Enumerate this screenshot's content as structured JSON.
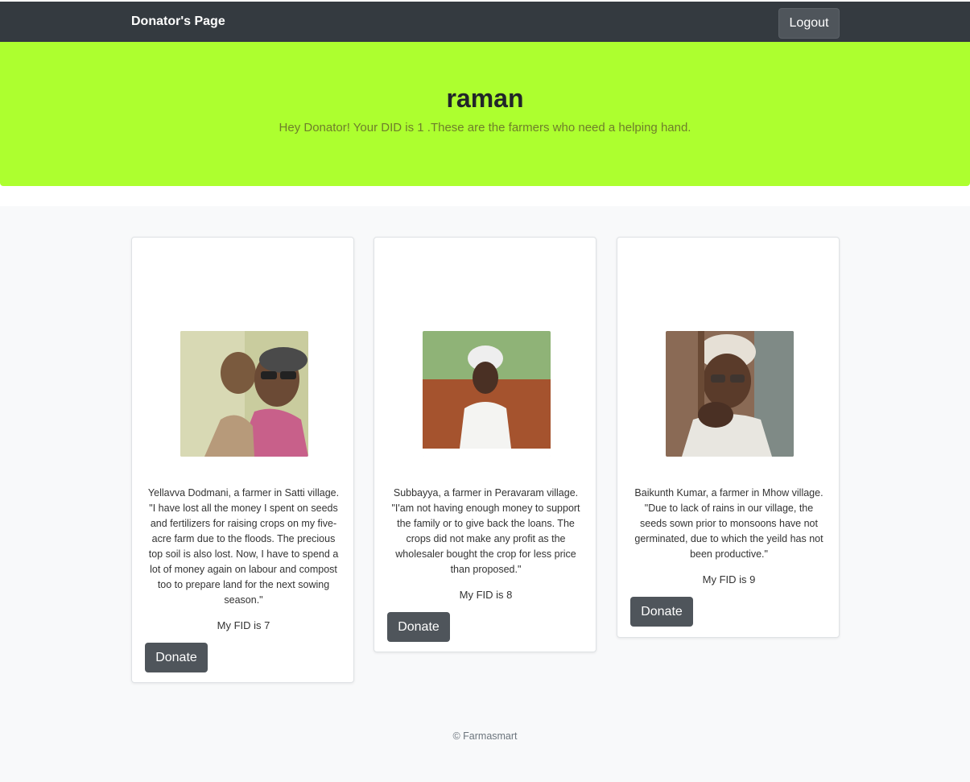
{
  "nav": {
    "brand": "Donator's Page",
    "logout_label": "Logout"
  },
  "hero": {
    "name": "raman",
    "lead": "Hey Donator! Your DID is 1 .These are the farmers who need a helping hand."
  },
  "cards": [
    {
      "story": "Yellavva Dodmani, a farmer in Satti village. \"I have lost all the money I spent on seeds and fertilizers for raising crops on my five-acre farm due to the floods. The precious top soil is also lost. Now, I have to spend a lot of money again on labour and compost too to prepare land for the next sowing season.\"",
      "fid": "My FID is 7",
      "donate_label": "Donate"
    },
    {
      "story": "Subbayya, a farmer in Peravaram village. \"I'am not having enough money to support the family or to give back the loans. The crops did not make any profit as the wholesaler bought the crop for less price than proposed.\"",
      "fid": "My FID is 8",
      "donate_label": "Donate"
    },
    {
      "story": "Baikunth Kumar, a farmer in Mhow village. \"Due to lack of rains in our village, the seeds sown prior to monsoons have not germinated, due to which the yeild has not been productive.\"",
      "fid": "My FID is 9",
      "donate_label": "Donate"
    }
  ],
  "footer": {
    "text": "© Farmasmart"
  },
  "colors": {
    "navbar": "#343a40",
    "hero": "#adff2f",
    "button": "#4f555b",
    "album": "#f8f9fa"
  }
}
